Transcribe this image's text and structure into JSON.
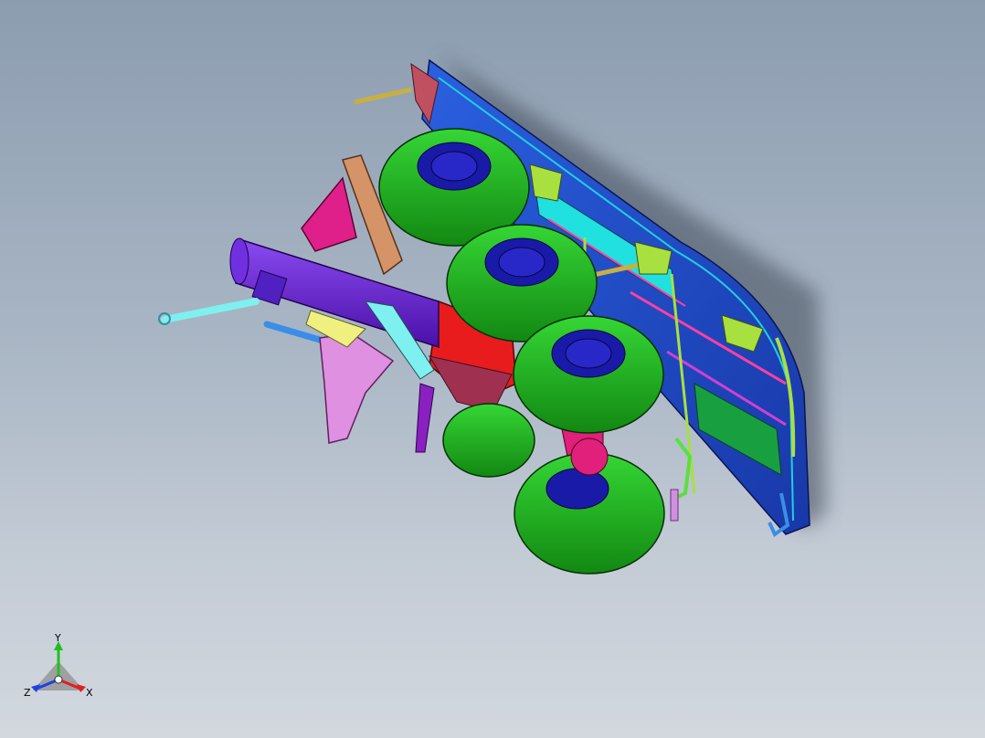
{
  "viewport": {
    "background_top": "#8c9db0",
    "background_bottom": "#d3d8df"
  },
  "model": {
    "colors": {
      "tire": "#1fbf1f",
      "tire_dark": "#118411",
      "hub": "#1a1aa8",
      "cylinder": "#6a1ed6",
      "brace_pink": "#e0208a",
      "brace_orange": "#d49468",
      "bracket_lavender": "#e090e0",
      "actuator_cyan": "#7ff0f0",
      "actuator_blue": "#3a8ee8",
      "frame_red": "#e81c1c",
      "panel_blue": "#2050d0",
      "panel_cyan": "#20e0e0",
      "strut_green": "#a8e040",
      "brown_link": "#8a3040"
    }
  },
  "triad": {
    "y_label": "Y",
    "x_label": "X",
    "z_label": "Z",
    "y_color": "#20c020",
    "x_color": "#e02020",
    "z_color": "#2040e0"
  }
}
